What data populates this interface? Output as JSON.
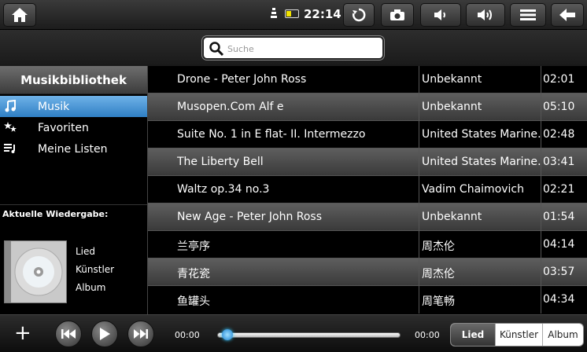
{
  "status": {
    "time": "22:14"
  },
  "search": {
    "placeholder": "Suche"
  },
  "sidebar": {
    "title": "Musikbibliothek",
    "items": [
      {
        "label": "Musik",
        "icon": "music-note-icon",
        "active": true
      },
      {
        "label": "Favoriten",
        "icon": "stars-icon",
        "active": false
      },
      {
        "label": "Meine Listen",
        "icon": "playlist-icon",
        "active": false
      }
    ]
  },
  "now_playing": {
    "heading": "Aktuelle Wiedergabe:",
    "song_label": "Lied",
    "artist_label": "Künstler",
    "album_label": "Album"
  },
  "tracks": [
    {
      "title": "Drone - Peter John Ross",
      "artist": "Unbekannt",
      "duration": "02:01"
    },
    {
      "title": "Musopen.Com  Alf e",
      "artist": "Unbekannt",
      "duration": "05:10"
    },
    {
      "title": "Suite No. 1 in E flat- II. Intermezzo",
      "artist": "United States Marine…",
      "duration": "02:48"
    },
    {
      "title": "The Liberty Bell",
      "artist": "United States Marine…",
      "duration": "03:41"
    },
    {
      "title": "Waltz op.34 no.3",
      "artist": "Vadim Chaimovich",
      "duration": "02:21"
    },
    {
      "title": "New Age - Peter John Ross",
      "artist": "Unbekannt",
      "duration": "01:54"
    },
    {
      "title": "兰亭序",
      "artist": "周杰伦",
      "duration": "04:14"
    },
    {
      "title": "青花瓷",
      "artist": "周杰伦",
      "duration": "03:57"
    },
    {
      "title": "鱼罐头",
      "artist": "周笔畅",
      "duration": "04:34"
    }
  ],
  "player": {
    "elapsed": "00:00",
    "total": "00:00",
    "progress": 0,
    "add_label": "+"
  },
  "views": {
    "song": "Lied",
    "artist": "Künstler",
    "album": "Album",
    "selected": "song"
  }
}
